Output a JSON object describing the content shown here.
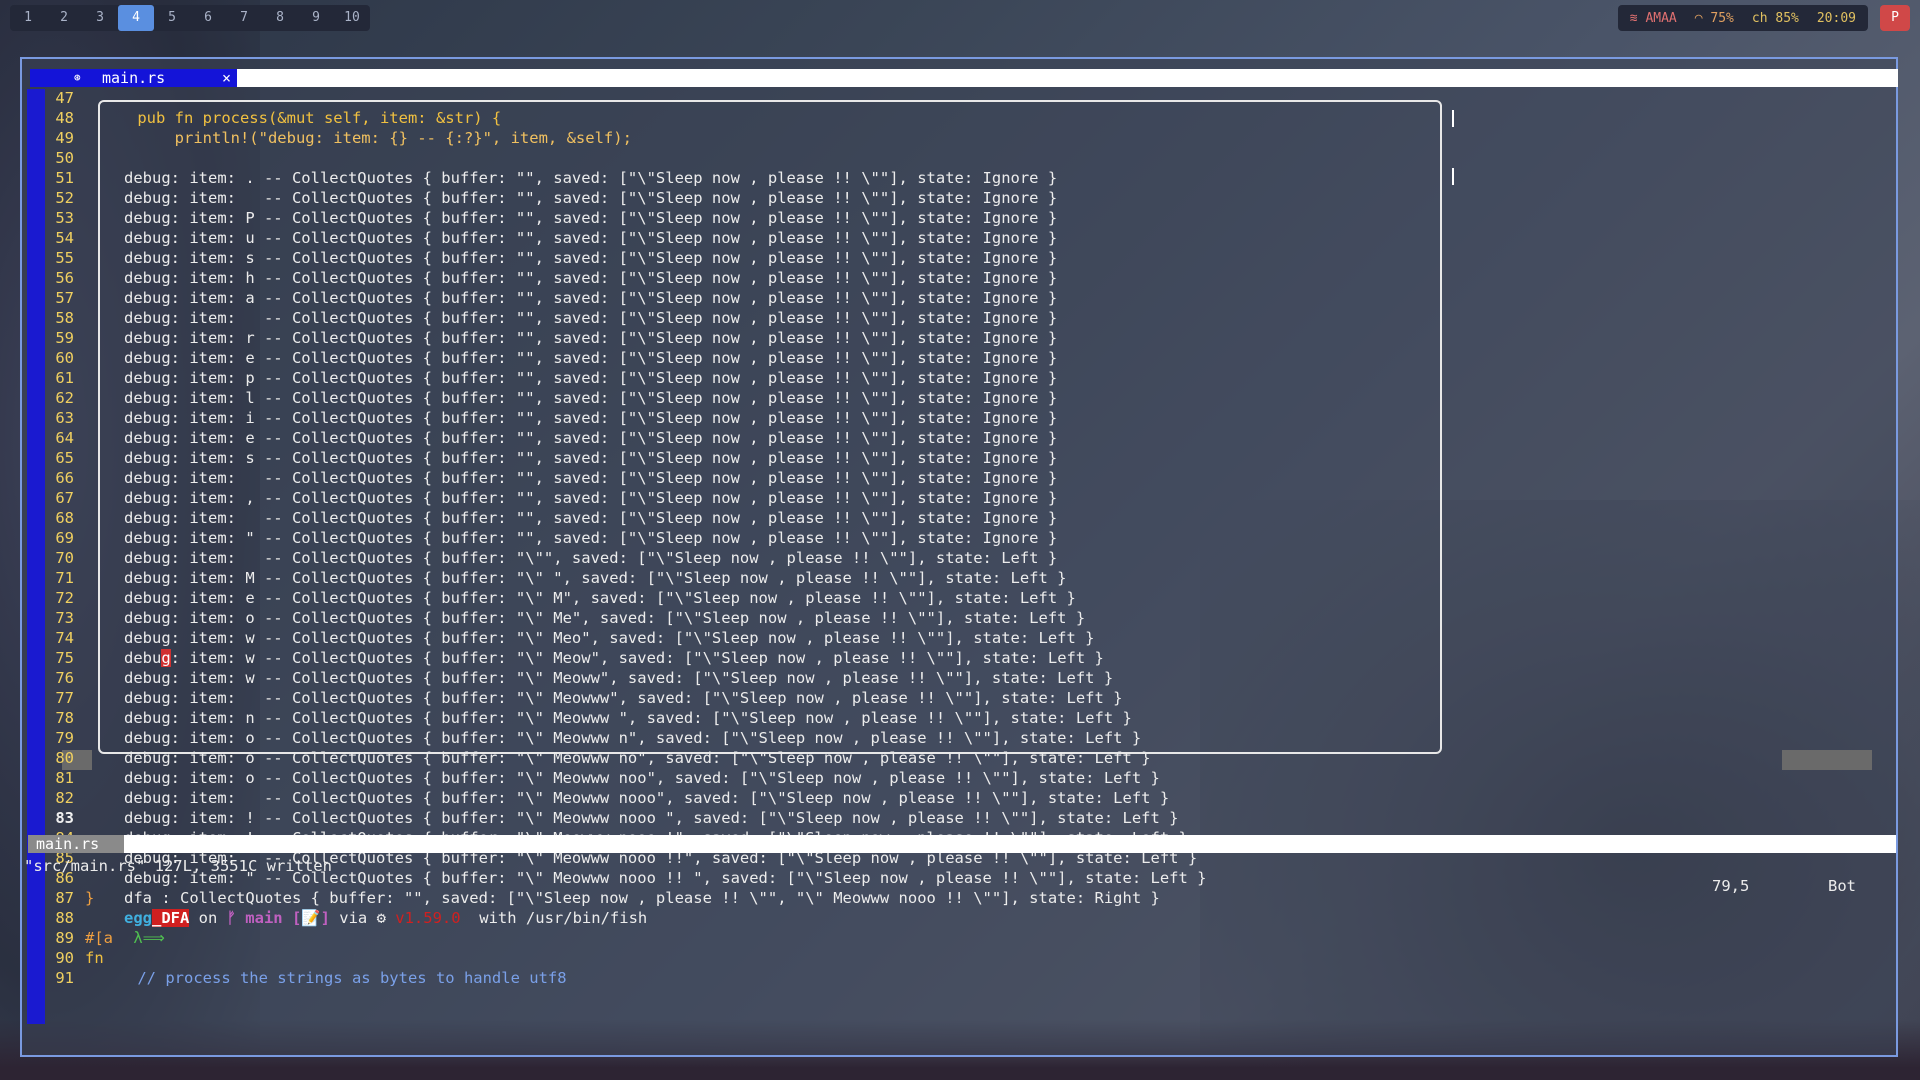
{
  "workspaces": [
    {
      "label": "1",
      "active": false
    },
    {
      "label": "2",
      "active": false
    },
    {
      "label": "3",
      "active": false
    },
    {
      "label": "4",
      "active": true
    },
    {
      "label": "5",
      "active": false
    },
    {
      "label": "6",
      "active": false
    },
    {
      "label": "7",
      "active": false
    },
    {
      "label": "8",
      "active": false
    },
    {
      "label": "9",
      "active": false
    },
    {
      "label": "10",
      "active": false
    }
  ],
  "status": {
    "wifi": "AMAA",
    "volume": "75%",
    "battery": "ch 85%",
    "time": "20:09",
    "power": "P"
  },
  "editor": {
    "tab_label": "main.rs",
    "tab_close": "×",
    "tab_dot": "⊛",
    "statusline_name": "main.rs",
    "cmdline": "\"src/main.rs\" 127L, 3551C written",
    "position": "79,5",
    "scroll": "Bot",
    "line_numbers": [
      "47",
      "48",
      "49",
      "50",
      "51",
      "52",
      "53",
      "54",
      "55",
      "56",
      "57",
      "58",
      "59",
      "60",
      "61",
      "62",
      "63",
      "64",
      "65",
      "66",
      "67",
      "68",
      "69",
      "70",
      "71",
      "72",
      "73",
      "74",
      "75",
      "76",
      "77",
      "78",
      "79",
      "80",
      "81",
      "82",
      "83",
      "84",
      "85",
      "86",
      "87",
      "88",
      "89",
      "90",
      "91"
    ],
    "current_line": "83",
    "code_48": "    pub fn process(&mut self, item: &str) {",
    "code_49": "        println!(\"debug: item: {} -- {:?}\", item, &self);",
    "code_87": "}",
    "code_89": "#[a",
    "code_90": "fn",
    "code_91": "    // process the strings as bytes to handle utf8"
  },
  "terminal": {
    "output": [
      "debug: item: . -- CollectQuotes { buffer: \"\", saved: [\"\\\"Sleep now , please !! \\\"\"], state: Ignore }",
      "debug: item:   -- CollectQuotes { buffer: \"\", saved: [\"\\\"Sleep now , please !! \\\"\"], state: Ignore }",
      "debug: item: P -- CollectQuotes { buffer: \"\", saved: [\"\\\"Sleep now , please !! \\\"\"], state: Ignore }",
      "debug: item: u -- CollectQuotes { buffer: \"\", saved: [\"\\\"Sleep now , please !! \\\"\"], state: Ignore }",
      "debug: item: s -- CollectQuotes { buffer: \"\", saved: [\"\\\"Sleep now , please !! \\\"\"], state: Ignore }",
      "debug: item: h -- CollectQuotes { buffer: \"\", saved: [\"\\\"Sleep now , please !! \\\"\"], state: Ignore }",
      "debug: item: a -- CollectQuotes { buffer: \"\", saved: [\"\\\"Sleep now , please !! \\\"\"], state: Ignore }",
      "debug: item:   -- CollectQuotes { buffer: \"\", saved: [\"\\\"Sleep now , please !! \\\"\"], state: Ignore }",
      "debug: item: r -- CollectQuotes { buffer: \"\", saved: [\"\\\"Sleep now , please !! \\\"\"], state: Ignore }",
      "debug: item: e -- CollectQuotes { buffer: \"\", saved: [\"\\\"Sleep now , please !! \\\"\"], state: Ignore }",
      "debug: item: p -- CollectQuotes { buffer: \"\", saved: [\"\\\"Sleep now , please !! \\\"\"], state: Ignore }",
      "debug: item: l -- CollectQuotes { buffer: \"\", saved: [\"\\\"Sleep now , please !! \\\"\"], state: Ignore }",
      "debug: item: i -- CollectQuotes { buffer: \"\", saved: [\"\\\"Sleep now , please !! \\\"\"], state: Ignore }",
      "debug: item: e -- CollectQuotes { buffer: \"\", saved: [\"\\\"Sleep now , please !! \\\"\"], state: Ignore }",
      "debug: item: s -- CollectQuotes { buffer: \"\", saved: [\"\\\"Sleep now , please !! \\\"\"], state: Ignore }",
      "debug: item:   -- CollectQuotes { buffer: \"\", saved: [\"\\\"Sleep now , please !! \\\"\"], state: Ignore }",
      "debug: item: , -- CollectQuotes { buffer: \"\", saved: [\"\\\"Sleep now , please !! \\\"\"], state: Ignore }",
      "debug: item:   -- CollectQuotes { buffer: \"\", saved: [\"\\\"Sleep now , please !! \\\"\"], state: Ignore }",
      "debug: item: \" -- CollectQuotes { buffer: \"\", saved: [\"\\\"Sleep now , please !! \\\"\"], state: Ignore }",
      "debug: item:   -- CollectQuotes { buffer: \"\\\"\", saved: [\"\\\"Sleep now , please !! \\\"\"], state: Left }",
      "debug: item: M -- CollectQuotes { buffer: \"\\\" \", saved: [\"\\\"Sleep now , please !! \\\"\"], state: Left }",
      "debug: item: e -- CollectQuotes { buffer: \"\\\" M\", saved: [\"\\\"Sleep now , please !! \\\"\"], state: Left }",
      "debug: item: o -- CollectQuotes { buffer: \"\\\" Me\", saved: [\"\\\"Sleep now , please !! \\\"\"], state: Left }",
      "debug: item: w -- CollectQuotes { buffer: \"\\\" Meo\", saved: [\"\\\"Sleep now , please !! \\\"\"], state: Left }",
      "debug: item: w -- CollectQuotes { buffer: \"\\\" Meow\", saved: [\"\\\"Sleep now , please !! \\\"\"], state: Left }",
      "debug: item: w -- CollectQuotes { buffer: \"\\\" Meoww\", saved: [\"\\\"Sleep now , please !! \\\"\"], state: Left }",
      "debug: item:   -- CollectQuotes { buffer: \"\\\" Meowww\", saved: [\"\\\"Sleep now , please !! \\\"\"], state: Left }",
      "debug: item: n -- CollectQuotes { buffer: \"\\\" Meowww \", saved: [\"\\\"Sleep now , please !! \\\"\"], state: Left }",
      "debug: item: o -- CollectQuotes { buffer: \"\\\" Meowww n\", saved: [\"\\\"Sleep now , please !! \\\"\"], state: Left }",
      "debug: item: o -- CollectQuotes { buffer: \"\\\" Meowww no\", saved: [\"\\\"Sleep now , please !! \\\"\"], state: Left }",
      "debug: item: o -- CollectQuotes { buffer: \"\\\" Meowww noo\", saved: [\"\\\"Sleep now , please !! \\\"\"], state: Left }",
      "debug: item:   -- CollectQuotes { buffer: \"\\\" Meowww nooo\", saved: [\"\\\"Sleep now , please !! \\\"\"], state: Left }",
      "debug: item: ! -- CollectQuotes { buffer: \"\\\" Meowww nooo \", saved: [\"\\\"Sleep now , please !! \\\"\"], state: Left }",
      "debug: item: ! -- CollectQuotes { buffer: \"\\\" Meowww nooo !\", saved: [\"\\\"Sleep now , please !! \\\"\"], state: Left }",
      "debug: item:   -- CollectQuotes { buffer: \"\\\" Meowww nooo !!\", saved: [\"\\\"Sleep now , please !! \\\"\"], state: Left }",
      "debug: item: \" -- CollectQuotes { buffer: \"\\\" Meowww nooo !! \", saved: [\"\\\"Sleep now , please !! \\\"\"], state: Left }",
      "dfa : CollectQuotes { buffer: \"\", saved: [\"\\\"Sleep now , please !! \\\"\", \"\\\" Meowww nooo !! \\\"\"], state: Right }"
    ],
    "cursor_row": 24,
    "prompt": {
      "dir_prefix": "egg",
      "dir_highlight": "_DFA",
      "on": " on ",
      "branch": "ᚠ main",
      "status": " [📝]",
      "via": " via ",
      "lang_icon": "⚙",
      "version": " v1.59.0",
      "with": "  with ",
      "shell": "/usr/bin/fish",
      "lambda": " λ⟹"
    }
  }
}
